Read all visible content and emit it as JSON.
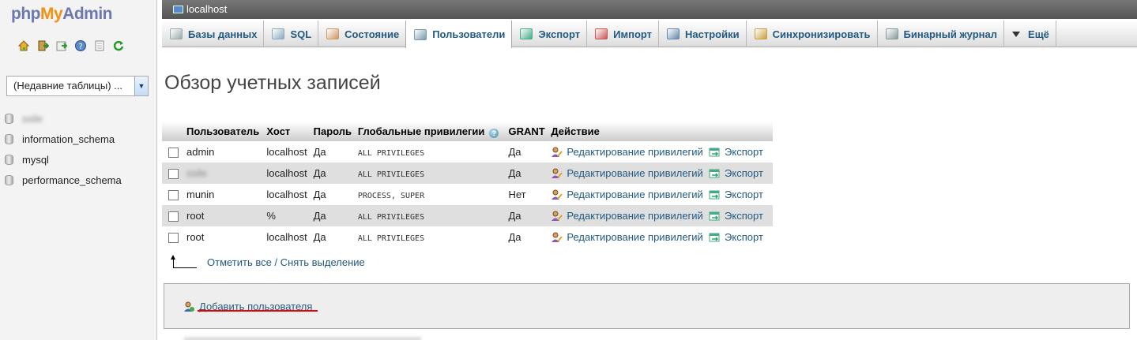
{
  "logo": {
    "php": "php",
    "my": "My",
    "admin": "Admin"
  },
  "sidebar": {
    "recent_tables": "(Недавние таблицы) ...",
    "databases": [
      {
        "name": "ssile",
        "blurred": true
      },
      {
        "name": "information_schema",
        "blurred": false
      },
      {
        "name": "mysql",
        "blurred": false
      },
      {
        "name": "performance_schema",
        "blurred": false
      }
    ]
  },
  "topbar": {
    "server": "localhost"
  },
  "tabs": [
    {
      "label": "Базы данных",
      "icon": "database-icon",
      "color": "#9aa"
    },
    {
      "label": "SQL",
      "icon": "sql-icon",
      "color": "#8ab"
    },
    {
      "label": "Состояние",
      "icon": "status-icon",
      "color": "#c96"
    },
    {
      "label": "Пользователи",
      "icon": "users-icon",
      "color": "#79a",
      "active": true
    },
    {
      "label": "Экспорт",
      "icon": "export-icon",
      "color": "#4a8"
    },
    {
      "label": "Импорт",
      "icon": "import-icon",
      "color": "#c55"
    },
    {
      "label": "Настройки",
      "icon": "wrench-icon",
      "color": "#68a"
    },
    {
      "label": "Синхронизировать",
      "icon": "sync-icon",
      "color": "#c9a040"
    },
    {
      "label": "Бинарный журнал",
      "icon": "binlog-icon",
      "color": "#899"
    },
    {
      "label": "Ещё",
      "icon": "more-icon",
      "color": "#333"
    }
  ],
  "main": {
    "title": "Обзор учетных записей",
    "table": {
      "headers": [
        "Пользователь",
        "Хост",
        "Пароль",
        "Глобальные привилегии",
        "GRANT",
        "Действие"
      ],
      "rows": [
        {
          "user": "admin",
          "host": "localhost",
          "password": "Да",
          "privileges": "ALL PRIVILEGES",
          "grant": "Да"
        },
        {
          "user": "ssile",
          "host": "localhost",
          "password": "Да",
          "privileges": "ALL PRIVILEGES",
          "grant": "Да",
          "blurred": true
        },
        {
          "user": "munin",
          "host": "localhost",
          "password": "Да",
          "privileges": "PROCESS, SUPER",
          "grant": "Нет"
        },
        {
          "user": "root",
          "host": "%",
          "password": "Да",
          "privileges": "ALL PRIVILEGES",
          "grant": "Да"
        },
        {
          "user": "root",
          "host": "localhost",
          "password": "Да",
          "privileges": "ALL PRIVILEGES",
          "grant": "Да"
        }
      ],
      "edit_label": "Редактирование привилегий",
      "export_label": "Экспорт"
    },
    "check_all": "Отметить все",
    "separator": " / ",
    "uncheck_all": "Снять выделение",
    "add_user": "Добавить пользователя"
  }
}
